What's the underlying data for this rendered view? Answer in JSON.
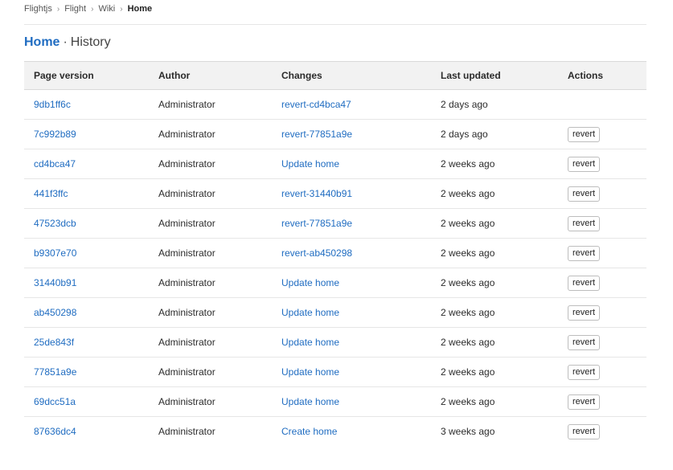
{
  "breadcrumb": {
    "items": [
      "Flightjs",
      "Flight",
      "Wiki"
    ],
    "current": "Home"
  },
  "title": {
    "page": "Home",
    "separator": "·",
    "subtitle": "History"
  },
  "table": {
    "columns": [
      "Page version",
      "Author",
      "Changes",
      "Last updated",
      "Actions"
    ],
    "rows": [
      {
        "version": "9db1ff6c",
        "author": "Administrator",
        "change": "revert-cd4bca47",
        "updated": "2 days ago",
        "action": ""
      },
      {
        "version": "7c992b89",
        "author": "Administrator",
        "change": "revert-77851a9e",
        "updated": "2 days ago",
        "action": "revert"
      },
      {
        "version": "cd4bca47",
        "author": "Administrator",
        "change": "Update home",
        "updated": "2 weeks ago",
        "action": "revert"
      },
      {
        "version": "441f3ffc",
        "author": "Administrator",
        "change": "revert-31440b91",
        "updated": "2 weeks ago",
        "action": "revert"
      },
      {
        "version": "47523dcb",
        "author": "Administrator",
        "change": "revert-77851a9e",
        "updated": "2 weeks ago",
        "action": "revert"
      },
      {
        "version": "b9307e70",
        "author": "Administrator",
        "change": "revert-ab450298",
        "updated": "2 weeks ago",
        "action": "revert"
      },
      {
        "version": "31440b91",
        "author": "Administrator",
        "change": "Update home",
        "updated": "2 weeks ago",
        "action": "revert"
      },
      {
        "version": "ab450298",
        "author": "Administrator",
        "change": "Update home",
        "updated": "2 weeks ago",
        "action": "revert"
      },
      {
        "version": "25de843f",
        "author": "Administrator",
        "change": "Update home",
        "updated": "2 weeks ago",
        "action": "revert"
      },
      {
        "version": "77851a9e",
        "author": "Administrator",
        "change": "Update home",
        "updated": "2 weeks ago",
        "action": "revert"
      },
      {
        "version": "69dcc51a",
        "author": "Administrator",
        "change": "Update home",
        "updated": "2 weeks ago",
        "action": "revert"
      },
      {
        "version": "87636dc4",
        "author": "Administrator",
        "change": "Create home",
        "updated": "3 weeks ago",
        "action": "revert"
      }
    ]
  },
  "colors": {
    "link": "#1f6cc1",
    "header_bg": "#f2f2f2",
    "divider": "#e6e6e6"
  },
  "icons": {
    "breadcrumb_separator": "chevron-right-icon"
  }
}
